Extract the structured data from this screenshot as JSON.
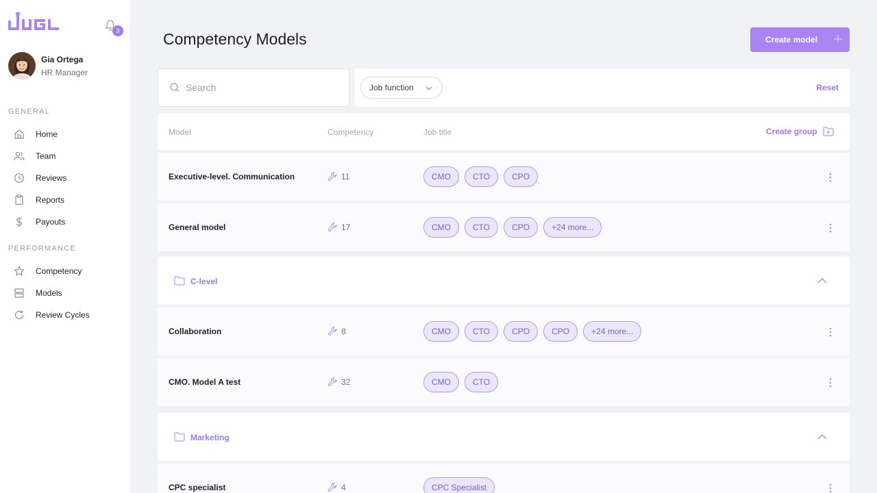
{
  "app": {
    "logo_text": "JUGL"
  },
  "notifications": {
    "count": "3"
  },
  "user": {
    "name": "Gia Ortega",
    "role": "HR Manager"
  },
  "nav": {
    "general_title": "GENERAL",
    "general": [
      {
        "label": "Home",
        "icon": "home-icon"
      },
      {
        "label": "Team",
        "icon": "team-icon"
      },
      {
        "label": "Reviews",
        "icon": "clock-icon"
      },
      {
        "label": "Reports",
        "icon": "clipboard-icon"
      },
      {
        "label": "Payouts",
        "icon": "dollar-icon"
      }
    ],
    "performance_title": "PERFORMANCE",
    "performance": [
      {
        "label": "Competency",
        "icon": "star-icon"
      },
      {
        "label": "Models",
        "icon": "stack-icon"
      },
      {
        "label": "Review Cycles",
        "icon": "refresh-icon"
      }
    ]
  },
  "page": {
    "title": "Competency Models",
    "create_label": "Create model"
  },
  "search": {
    "placeholder": "Search"
  },
  "filters": {
    "job_function_label": "Job function",
    "reset_label": "Reset"
  },
  "table": {
    "headers": {
      "model": "Model",
      "competency": "Competency",
      "job_title": "Job title"
    },
    "create_group_label": "Create group"
  },
  "rows": [
    {
      "kind": "model",
      "name": "Executive-level. Communication",
      "competency": "11",
      "tags": [
        "CMO",
        "CTO",
        "CPO"
      ]
    },
    {
      "kind": "model",
      "name": "General model",
      "competency": "17",
      "tags": [
        "CMO",
        "CTO",
        "CPO",
        "+24 more..."
      ]
    },
    {
      "kind": "group",
      "name": "C-level"
    },
    {
      "kind": "model",
      "name": "Collaboration",
      "competency": "8",
      "tags": [
        "CMO",
        "CTO",
        "CPO",
        "CPO",
        "+24 more..."
      ]
    },
    {
      "kind": "model",
      "name": "CMO. Model A test",
      "competency": "32",
      "tags": [
        "CMO",
        "CTO"
      ]
    },
    {
      "kind": "group",
      "name": "Marketing"
    },
    {
      "kind": "model",
      "name": "CPC specialist",
      "competency": "4",
      "tags": [
        "CPC Specialist"
      ]
    }
  ],
  "colors": {
    "accent": "#a885f3",
    "accent_text": "#9b7ae8",
    "tag_bg": "#ece6fb",
    "tag_border": "#b39af0"
  }
}
